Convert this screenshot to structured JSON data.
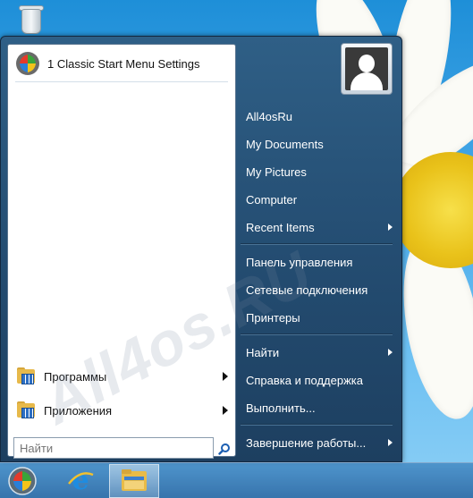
{
  "desktop": {
    "recycle_bin_icon": "recycle-bin-icon"
  },
  "start_menu": {
    "pinned": {
      "label": "1 Classic Start Menu Settings",
      "icon": "classic-shell-logo-icon"
    },
    "watermark": "All4os.RU",
    "programs": [
      {
        "label": "Программы",
        "icon": "programs-folder-icon",
        "has_submenu": true
      },
      {
        "label": "Приложения",
        "icon": "apps-folder-icon",
        "has_submenu": true
      }
    ],
    "search": {
      "placeholder": "Найти",
      "value": "",
      "icon": "search-icon"
    },
    "user": {
      "icon": "user-avatar-icon"
    },
    "right_items": [
      {
        "label": "All4osRu",
        "has_submenu": false
      },
      {
        "label": "My Documents",
        "has_submenu": false
      },
      {
        "label": "My Pictures",
        "has_submenu": false
      },
      {
        "label": "Computer",
        "has_submenu": false
      },
      {
        "label": "Recent Items",
        "has_submenu": true
      },
      {
        "label": "Панель управления",
        "has_submenu": false
      },
      {
        "label": "Сетевые подключения",
        "has_submenu": false
      },
      {
        "label": "Принтеры",
        "has_submenu": false
      },
      {
        "label": "Найти",
        "has_submenu": true
      },
      {
        "label": "Справка и поддержка",
        "has_submenu": false
      },
      {
        "label": "Выполнить...",
        "has_submenu": false
      },
      {
        "label": "Завершение работы...",
        "has_submenu": true
      }
    ]
  },
  "taskbar": {
    "start_icon": "start-orb-icon",
    "pinned": [
      {
        "icon": "internet-explorer-icon",
        "active": false
      },
      {
        "icon": "file-explorer-icon",
        "active": true
      }
    ]
  },
  "colors": {
    "menu_bg": "#2a5a80",
    "taskbar": "#3a7fbd",
    "desktop": "#3aa0e2"
  }
}
